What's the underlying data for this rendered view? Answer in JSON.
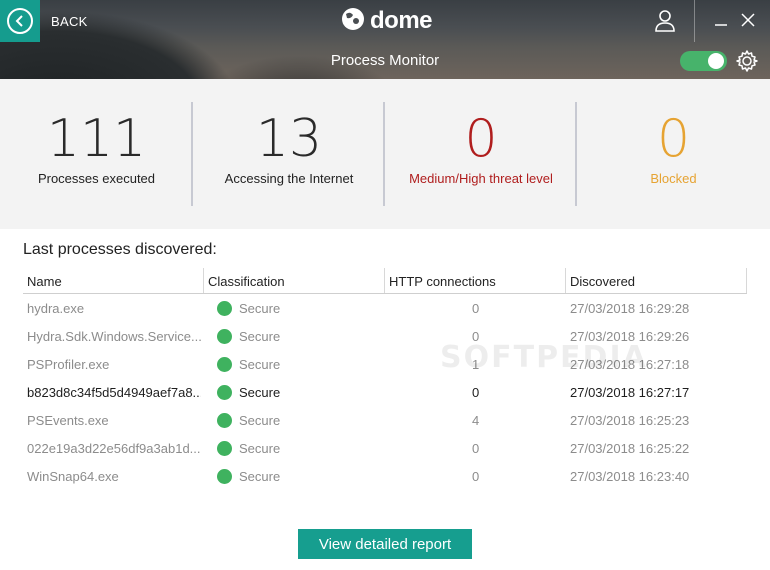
{
  "header": {
    "back_label": "BACK",
    "brand": "dome",
    "title": "Process Monitor",
    "toggle_on": true,
    "accent_color": "#159c8e",
    "toggle_color": "#47b36b"
  },
  "stats": [
    {
      "value": "111",
      "label": "Processes executed",
      "color": "#2a2a2a"
    },
    {
      "value": "13",
      "label": "Accessing the Internet",
      "color": "#2a2a2a"
    },
    {
      "value": "0",
      "label": "Medium/High threat level",
      "color": "#b01e1e"
    },
    {
      "value": "0",
      "label": "Blocked",
      "color": "#e6a332"
    }
  ],
  "section_title": "Last processes discovered:",
  "table": {
    "columns": [
      "Name",
      "Classification",
      "HTTP connections",
      "Discovered"
    ],
    "rows": [
      {
        "name": "hydra.exe",
        "classification": "Secure",
        "http": "0",
        "discovered": "27/03/2018 16:29:28"
      },
      {
        "name": "Hydra.Sdk.Windows.Service....",
        "classification": "Secure",
        "http": "0",
        "discovered": "27/03/2018 16:29:26"
      },
      {
        "name": "PSProfiler.exe",
        "classification": "Secure",
        "http": "1",
        "discovered": "27/03/2018 16:27:18"
      },
      {
        "name": "b823d8c34f5d5d4949aef7a8...",
        "classification": "Secure",
        "http": "0",
        "discovered": "27/03/2018 16:27:17"
      },
      {
        "name": "PSEvents.exe",
        "classification": "Secure",
        "http": "4",
        "discovered": "27/03/2018 16:25:23"
      },
      {
        "name": "022e19a3d22e56df9a3ab1d...",
        "classification": "Secure",
        "http": "0",
        "discovered": "27/03/2018 16:25:22"
      },
      {
        "name": "WinSnap64.exe",
        "classification": "Secure",
        "http": "0",
        "discovered": "27/03/2018 16:23:40"
      }
    ],
    "secure_color": "#3fb25f"
  },
  "watermark": "SOFTPEDIA",
  "report_button": "View detailed report"
}
